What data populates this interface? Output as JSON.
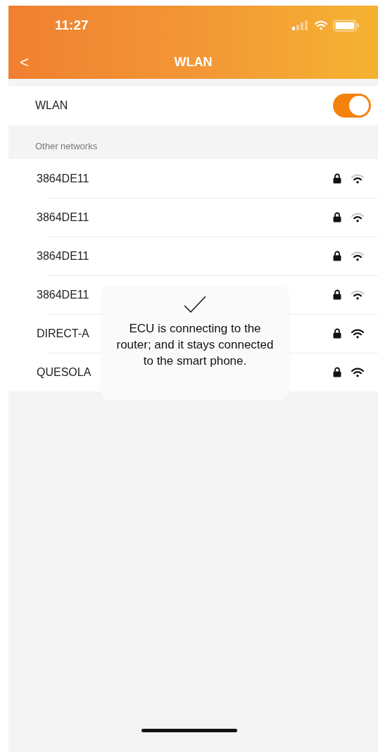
{
  "status_bar": {
    "time": "11:27"
  },
  "nav": {
    "back": "<",
    "title": "WLAN"
  },
  "wlan": {
    "label": "WLAN",
    "on": true
  },
  "section": "Other networks",
  "networks": [
    {
      "name": "3864DE11",
      "locked": true,
      "strong": false
    },
    {
      "name": "3864DE11",
      "locked": true,
      "strong": false
    },
    {
      "name": "3864DE11",
      "locked": true,
      "strong": false
    },
    {
      "name": "3864DE11",
      "locked": true,
      "strong": false
    },
    {
      "name": "DIRECT-A",
      "locked": true,
      "strong": true
    },
    {
      "name": "QUESOLA",
      "locked": true,
      "strong": true
    }
  ],
  "toast": {
    "message": "ECU is connecting to the router; and it stays connected to the smart phone."
  }
}
